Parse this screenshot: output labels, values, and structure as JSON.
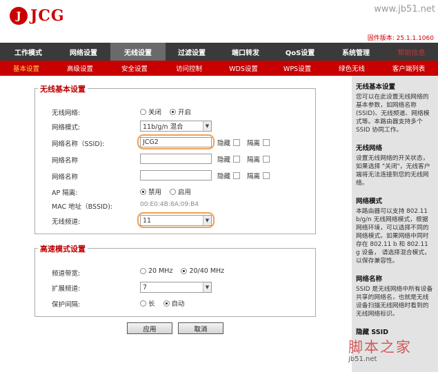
{
  "header": {
    "logo_mark": "J",
    "logo_text": "JCG",
    "watermark_url": "www.jb51.net",
    "firmware": "固件版本: 25.1.1.1060"
  },
  "mainnav": {
    "items": [
      "工作模式",
      "网络设置",
      "无线设置",
      "过滤设置",
      "端口转发",
      "QoS设置",
      "系统管理"
    ],
    "help": "帮助信息"
  },
  "subnav": {
    "items": [
      "基本设置",
      "高级设置",
      "安全设置",
      "访问控制",
      "WDS设置",
      "WPS设置",
      "绿色无线",
      "客户端列表"
    ]
  },
  "basic": {
    "title": "无线基本设置",
    "wireless_label": "无线网络:",
    "wireless_off": "关闭",
    "wireless_on": "开启",
    "mode_label": "网络模式:",
    "mode_value": "11b/g/n 混合",
    "ssid_label": "网络名称（SSID):",
    "ssid_value": "JCG2",
    "ssid2_label": "网络名称",
    "ssid3_label": "网络名称",
    "hide_label": "隐藏",
    "isolate_label": "隔离",
    "ap_label": "AP 隔离:",
    "ap_disable": "禁用",
    "ap_enable": "启用",
    "mac_label": "MAC 地址（BSSID):",
    "mac_value": "00:E0:4B:8A:09:B4",
    "channel_label": "无线频道:",
    "channel_value": "11"
  },
  "advanced": {
    "title": "高速模式设置",
    "bandwidth_label": "频道带宽:",
    "bw_20": "20 MHz",
    "bw_40": "20/40 MHz",
    "ext_label": "扩展频道:",
    "ext_value": "7",
    "guard_label": "保护间隔:",
    "guard_long": "长",
    "guard_auto": "自动"
  },
  "buttons": {
    "apply": "应用",
    "cancel": "取消"
  },
  "sidebar": {
    "b1_title": "无线基本设置",
    "b1_text": "您可以在此设置无线网络的基本参数，如网络名称(SSID)、无线频道、网络模式等。本路由器支持多个SSID 协同工作。",
    "b2_title": "无线网络",
    "b2_text": "设置无线网络的开关状态，如果选择 \"关闭\"，无线客户端将无法连接到您的无线网络。",
    "b3_title": "网络模式",
    "b3_text": "本路由器可以支持 802.11 b/g/n 无线网络模式，根据网络环境，可以选择不同的网络模式。如果网络中同时存在 802.11 b 和 802.11 g 设备， 请选择混合模式，以保存兼容性。",
    "b4_title": "网络名称",
    "b4_text": "SSID 是无线网络中所有设备共享的网络名，也就是无线设备扫描无线网络时看到的无线网络标识。",
    "b5_title": "隐藏 SSID"
  },
  "site_watermark": {
    "big": "脚本之家",
    "small": "jb51.net"
  }
}
